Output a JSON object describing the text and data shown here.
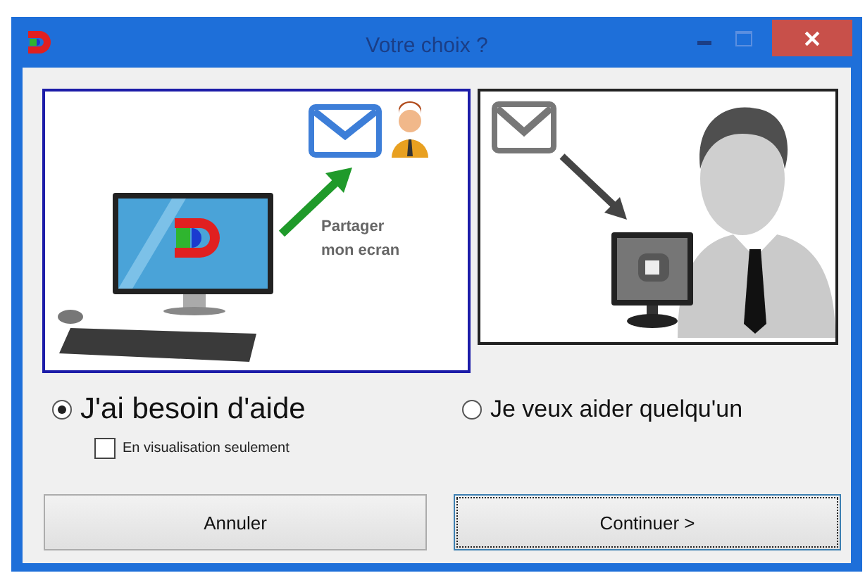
{
  "window": {
    "title": "Votre choix ?"
  },
  "options": [
    {
      "kind": "share",
      "label": "J'ai besoin d'aide",
      "selected": true,
      "caption": [
        "Partager",
        "mon ecran"
      ],
      "suboption": {
        "label": "En visualisation seulement",
        "checked": false
      }
    },
    {
      "kind": "help",
      "label": "Je veux aider quelqu'un",
      "selected": false
    }
  ],
  "buttons": [
    {
      "label": "Annuler",
      "focused": false
    },
    {
      "label": "Continuer >",
      "focused": true
    }
  ]
}
